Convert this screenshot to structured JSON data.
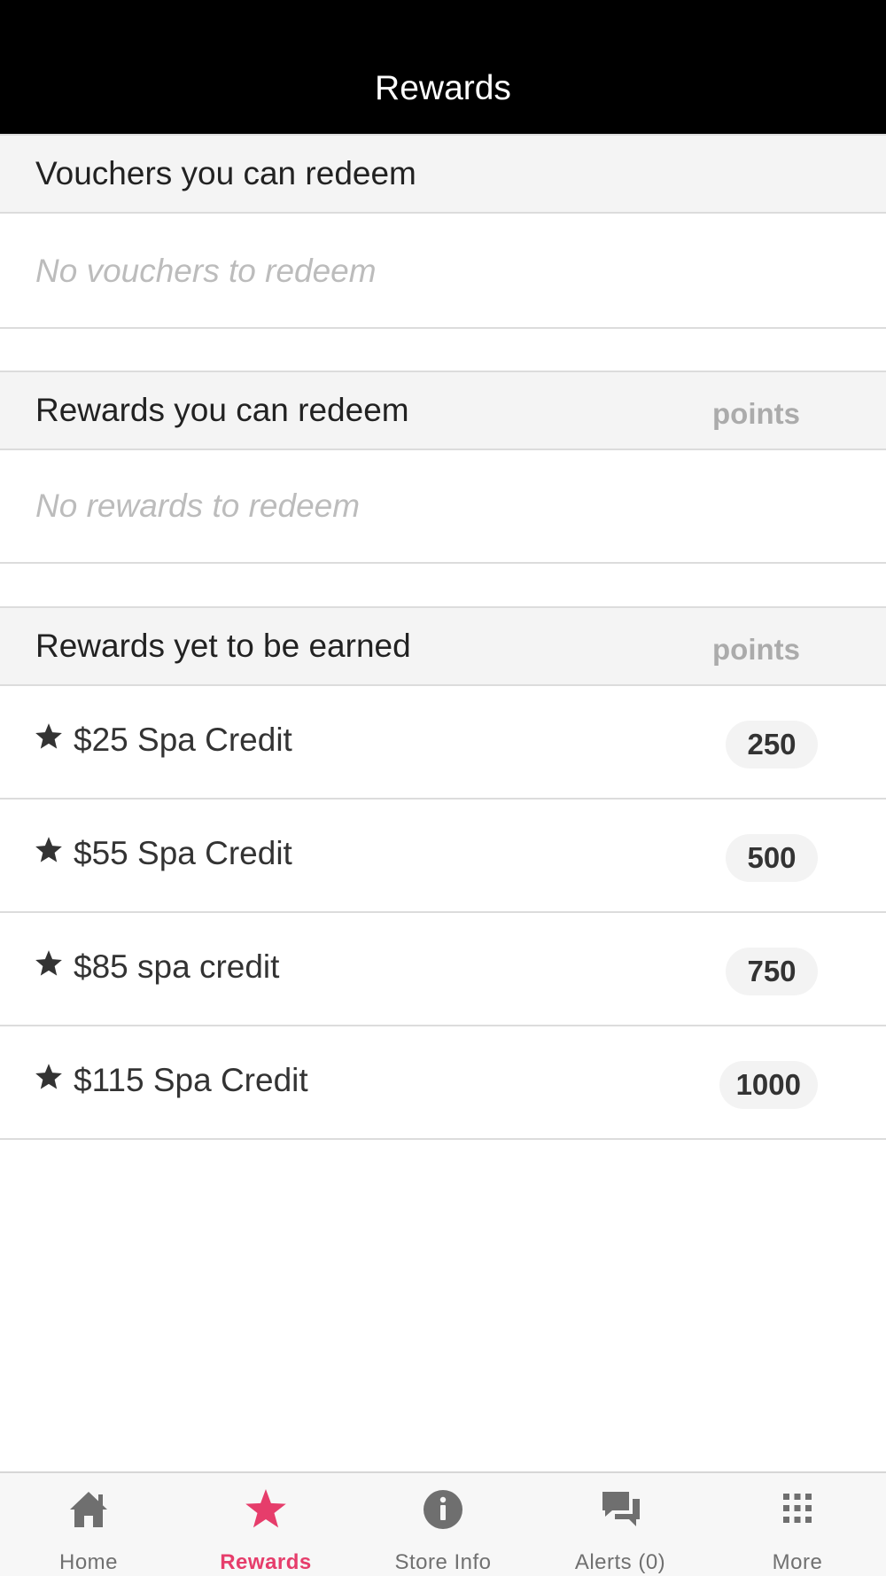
{
  "header": {
    "title": "Rewards"
  },
  "vouchers": {
    "title": "Vouchers you can redeem",
    "empty": "No vouchers to redeem"
  },
  "redeemable": {
    "title": "Rewards you can redeem",
    "points_label": "points",
    "empty": "No rewards to redeem"
  },
  "unearned": {
    "title": "Rewards yet to be earned",
    "points_label": "points",
    "items": [
      {
        "label": "$25 Spa Credit",
        "points": "250"
      },
      {
        "label": "$55 Spa Credit",
        "points": "500"
      },
      {
        "label": "$85 spa credit",
        "points": "750"
      },
      {
        "label": "$115 Spa Credit",
        "points": "1000"
      }
    ]
  },
  "tabbar": {
    "active": "Rewards",
    "accent_color": "#e63d6b",
    "tabs": [
      {
        "label": "Home",
        "icon": "home-icon"
      },
      {
        "label": "Rewards",
        "icon": "star-icon"
      },
      {
        "label": "Store Info",
        "icon": "info-icon"
      },
      {
        "label": "Alerts (0)",
        "icon": "chat-bubbles-icon"
      },
      {
        "label": "More",
        "icon": "grid-dots-icon"
      }
    ]
  }
}
